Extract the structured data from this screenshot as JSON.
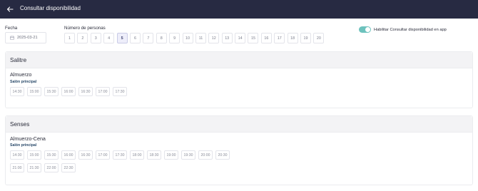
{
  "header": {
    "title": "Consultar disponibilidad",
    "back_icon": "arrow-left-icon"
  },
  "filters": {
    "date_label": "Fecha",
    "date_value": "2025-03-21",
    "persons_label": "Número de personas",
    "persons": [
      "1",
      "2",
      "3",
      "4",
      "5",
      "6",
      "7",
      "8",
      "9",
      "10",
      "11",
      "12",
      "13",
      "14",
      "15",
      "16",
      "17",
      "18",
      "19",
      "20"
    ],
    "selected_persons": "5",
    "toggle_label": "Habilitar Consultar disponibilidad en app",
    "toggle_on": true
  },
  "restaurants": [
    {
      "name": "Salitre",
      "service": "Almuerzo",
      "room": "Salón principal",
      "slots": [
        "14:30",
        "15:00",
        "15:30",
        "16:00",
        "16:30",
        "17:00",
        "17:30"
      ]
    },
    {
      "name": "Senses",
      "service": "Almuerzo-Cena",
      "room": "Salón principal",
      "slots": [
        "14:30",
        "15:00",
        "15:30",
        "16:00",
        "16:30",
        "17:00",
        "17:30",
        "18:00",
        "18:30",
        "19:00",
        "19:30",
        "20:00",
        "20:30",
        "21:00",
        "21:30",
        "22:00",
        "22:30"
      ]
    }
  ],
  "colors": {
    "topbar": "#272a42",
    "toggle": "#6dc2bd",
    "selected": "#eeeefa"
  }
}
